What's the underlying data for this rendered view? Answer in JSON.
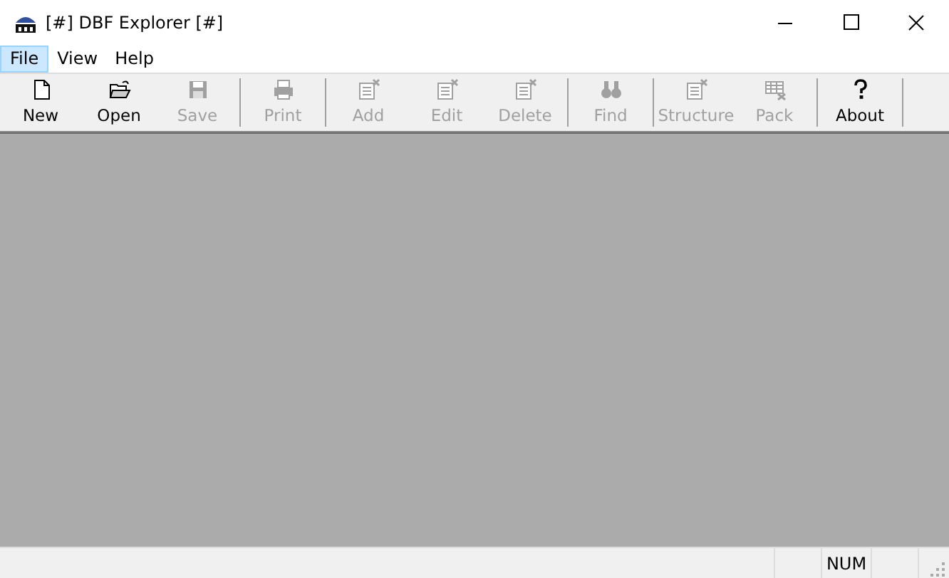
{
  "window": {
    "title": "[#] DBF Explorer [#]"
  },
  "menu": [
    {
      "label": "File",
      "selected": true
    },
    {
      "label": "View",
      "selected": false
    },
    {
      "label": "Help",
      "selected": false
    }
  ],
  "toolbar": {
    "groups": [
      [
        {
          "label": "New",
          "kind": "new",
          "disabled": false
        },
        {
          "label": "Open",
          "kind": "open",
          "disabled": false
        },
        {
          "label": "Save",
          "kind": "save",
          "disabled": true
        }
      ],
      [
        {
          "label": "Print",
          "kind": "print",
          "disabled": true
        }
      ],
      [
        {
          "label": "Add",
          "kind": "add",
          "disabled": true
        },
        {
          "label": "Edit",
          "kind": "edit",
          "disabled": true
        },
        {
          "label": "Delete",
          "kind": "delete",
          "disabled": true
        }
      ],
      [
        {
          "label": "Find",
          "kind": "find",
          "disabled": true
        }
      ],
      [
        {
          "label": "Structure",
          "kind": "structure",
          "disabled": true
        },
        {
          "label": "Pack",
          "kind": "pack",
          "disabled": true
        }
      ],
      [
        {
          "label": "About",
          "kind": "about",
          "disabled": false
        }
      ]
    ]
  },
  "status_bar": {
    "num": "NUM"
  }
}
